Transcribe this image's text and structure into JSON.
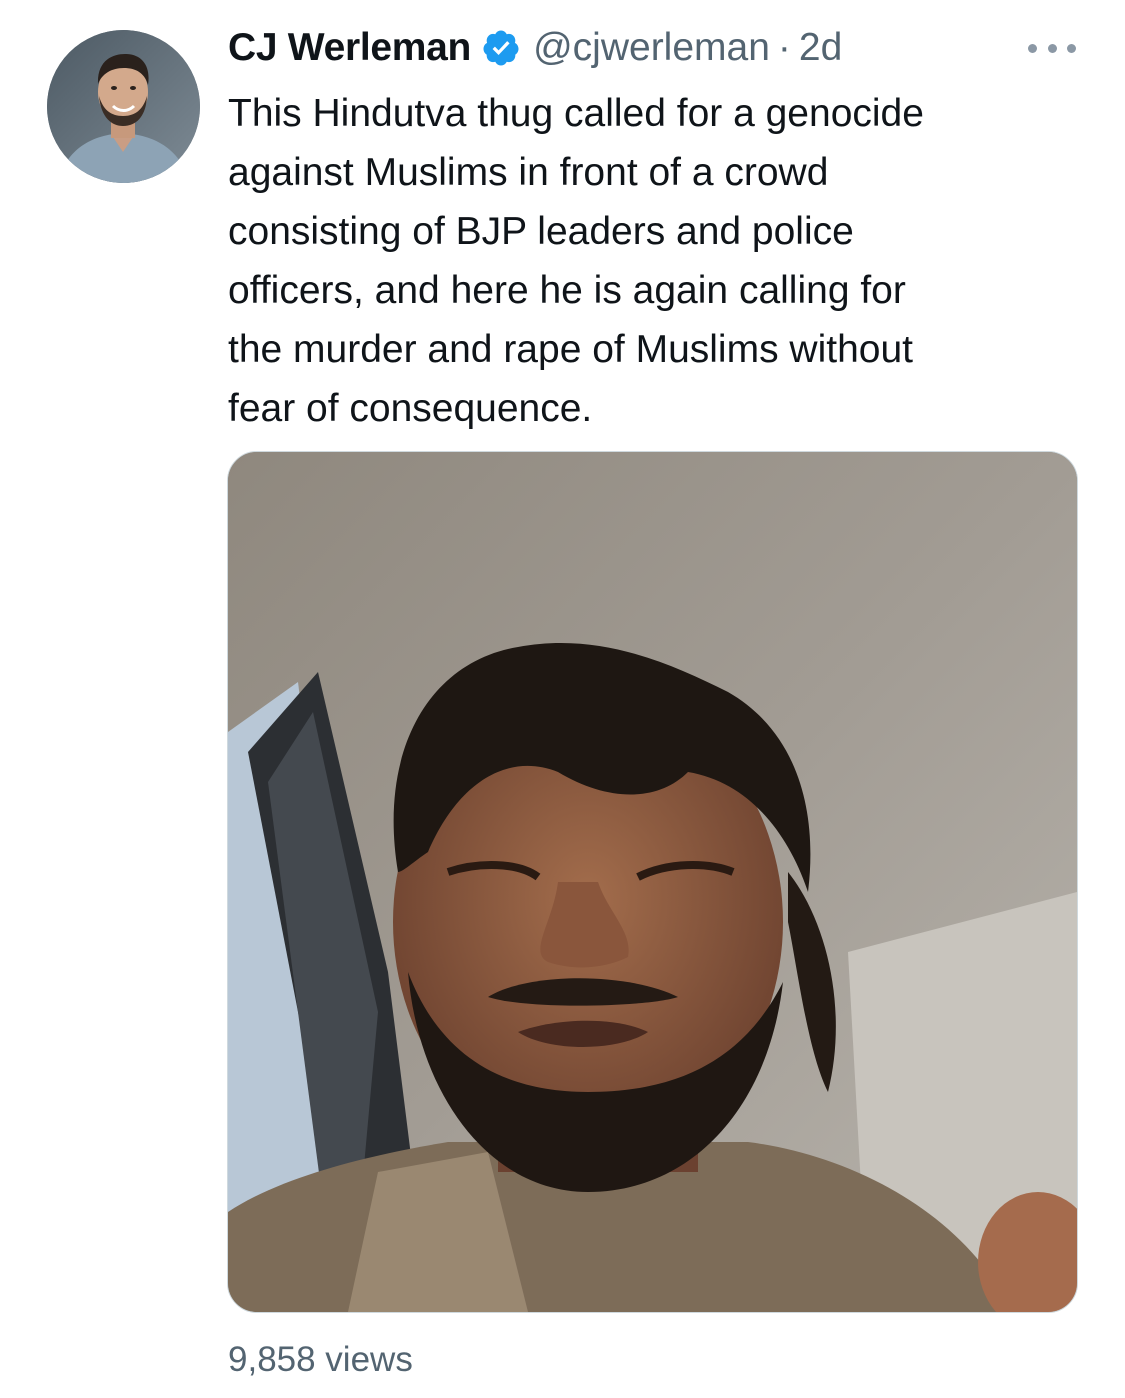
{
  "author": {
    "display_name": "CJ Werleman",
    "handle": "@cjwerleman",
    "separator": "·",
    "time": "2d",
    "verified": true,
    "verified_color": "#1d9bf0",
    "avatar_icon": "profile-photo"
  },
  "tweet": {
    "text": "This Hindutva thug called for a genocide\nagainst Muslims in front of a crowd\nconsisting of BJP leaders and police\nofficers, and here he is again calling for\nthe murder and rape of Muslims without\nfear of consequence."
  },
  "media": {
    "type": "video",
    "views_label": "9,858 views"
  },
  "actions": {
    "more_icon": "more-dots-icon"
  }
}
